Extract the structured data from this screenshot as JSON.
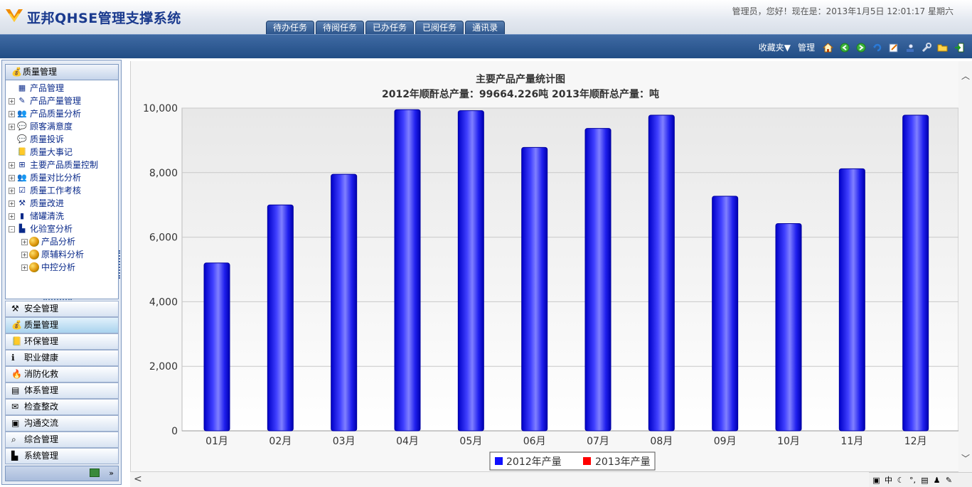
{
  "header": {
    "app_title": "亚邦QHSE管理支撑系统",
    "user_info": "管理员，您好！现在是：2013年1月5日  12:01:17 星期六",
    "tabs": [
      {
        "label": "待办任务"
      },
      {
        "label": "待阅任务"
      },
      {
        "label": "已办任务"
      },
      {
        "label": "已阅任务"
      },
      {
        "label": "通讯录"
      }
    ]
  },
  "toolbar": {
    "favorites_label": "收藏夹▼",
    "manage_label": "管理",
    "icons": [
      "home-icon",
      "back-icon",
      "forward-icon",
      "refresh-icon",
      "edit-icon",
      "user-icon",
      "settings-icon",
      "folder-icon",
      "exit-icon"
    ]
  },
  "sidebar": {
    "header_label": "质量管理",
    "tree": [
      {
        "label": "产品管理",
        "expander": "",
        "icon": "grid-icon",
        "level": 0
      },
      {
        "label": "产品产量管理",
        "expander": "+",
        "icon": "edit-icon",
        "level": 0
      },
      {
        "label": "产品质量分析",
        "expander": "+",
        "icon": "people-icon",
        "level": 0
      },
      {
        "label": "顾客满意度",
        "expander": "+",
        "icon": "chat-icon",
        "level": 0
      },
      {
        "label": "质量投诉",
        "expander": "",
        "icon": "chat-icon",
        "level": 0
      },
      {
        "label": "质量大事记",
        "expander": "",
        "icon": "book-icon",
        "level": 0
      },
      {
        "label": "主要产品质量控制",
        "expander": "+",
        "icon": "network-icon",
        "level": 0
      },
      {
        "label": "质量对比分析",
        "expander": "+",
        "icon": "people-icon",
        "level": 0
      },
      {
        "label": "质量工作考核",
        "expander": "+",
        "icon": "checklist-icon",
        "level": 0
      },
      {
        "label": "质量改进",
        "expander": "+",
        "icon": "tools-icon",
        "level": 0
      },
      {
        "label": "储罐清洗",
        "expander": "+",
        "icon": "tank-icon",
        "level": 0
      },
      {
        "label": "化验室分析",
        "expander": "-",
        "icon": "chart-icon",
        "level": 0
      },
      {
        "label": "产品分析",
        "expander": "+",
        "icon": "globe-icon",
        "level": 1
      },
      {
        "label": "原辅料分析",
        "expander": "+",
        "icon": "globe-icon",
        "level": 1
      },
      {
        "label": "中控分析",
        "expander": "+",
        "icon": "globe-icon",
        "level": 1
      }
    ],
    "accordion": [
      {
        "label": "安全管理",
        "icon": "tools-icon",
        "selected": false
      },
      {
        "label": "质量管理",
        "icon": "medal-icon",
        "selected": true
      },
      {
        "label": "环保管理",
        "icon": "book-icon",
        "selected": false
      },
      {
        "label": "职业健康",
        "icon": "info-icon",
        "selected": false
      },
      {
        "label": "消防化救",
        "icon": "fire-icon",
        "selected": false
      },
      {
        "label": "体系管理",
        "icon": "doc-icon",
        "selected": false
      },
      {
        "label": "检查整改",
        "icon": "mail-icon",
        "selected": false
      },
      {
        "label": "沟通交流",
        "icon": "box-icon",
        "selected": false
      },
      {
        "label": "综合管理",
        "icon": "search-icon",
        "selected": false
      },
      {
        "label": "系统管理",
        "icon": "chart-icon",
        "selected": false
      }
    ]
  },
  "chart_data": {
    "type": "bar",
    "title": "主要产品产量统计图",
    "subtitle": "2012年顺酐总产量：99664.226吨 2013年顺酐总产量：吨",
    "categories": [
      "01月",
      "02月",
      "03月",
      "04月",
      "05月",
      "06月",
      "07月",
      "08月",
      "09月",
      "10月",
      "11月",
      "12月"
    ],
    "series": [
      {
        "name": "2012年产量",
        "color": "#1010ff",
        "values": [
          5200,
          7000,
          7950,
          9950,
          9920,
          8780,
          9370,
          9780,
          7270,
          6420,
          8120,
          9780
        ]
      },
      {
        "name": "2013年产量",
        "color": "#ff0000",
        "values": []
      }
    ],
    "ylim": [
      0,
      10000
    ],
    "yticks": [
      "0",
      "2,000",
      "4,000",
      "6,000",
      "8,000",
      "10,000"
    ],
    "ytick_values": [
      0,
      2000,
      4000,
      6000,
      8000,
      10000
    ],
    "grid": true,
    "legend_position": "bottom-center"
  }
}
